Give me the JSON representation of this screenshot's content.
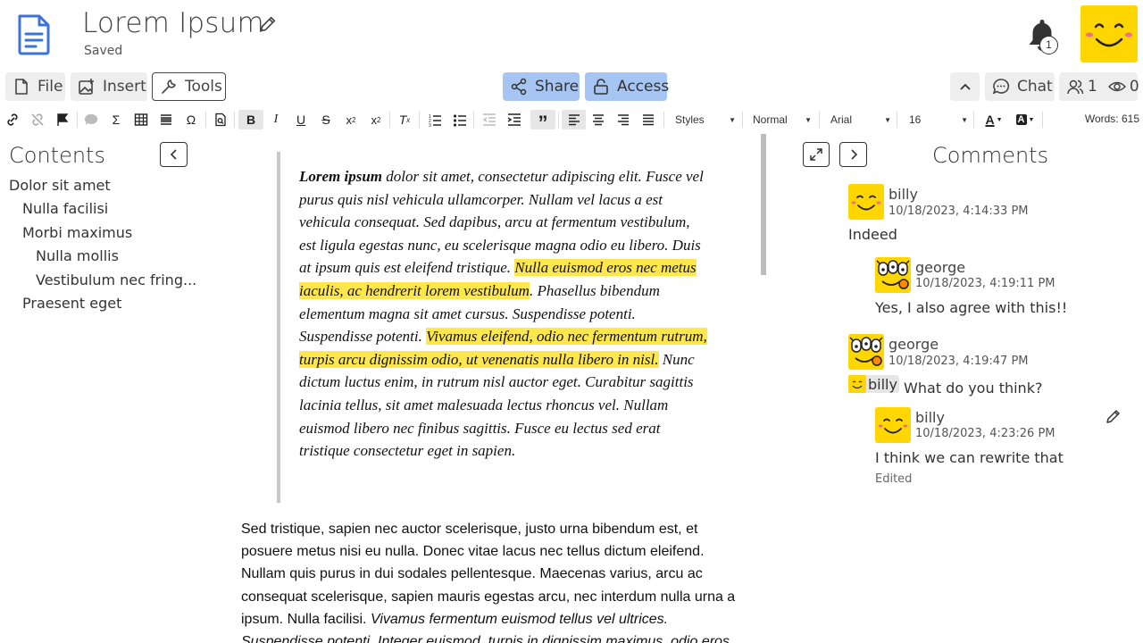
{
  "header": {
    "title": "Lorem Ipsum",
    "status": "Saved",
    "notification_count": "1"
  },
  "menu": {
    "file": "File",
    "insert": "Insert",
    "tools": "Tools",
    "share": "Share",
    "access": "Access",
    "chat": "Chat",
    "users_count": "1",
    "viewers_count": "0"
  },
  "toolbar": {
    "styles": "Styles",
    "paragraph": "Normal",
    "font": "Arial",
    "size": "16",
    "words": "Words: 615"
  },
  "contents": {
    "title": "Contents",
    "items": [
      {
        "label": "Dolor sit amet",
        "level": 0
      },
      {
        "label": "Nulla facilisi",
        "level": 1
      },
      {
        "label": "Morbi maximus",
        "level": 1
      },
      {
        "label": "Nulla mollis",
        "level": 2
      },
      {
        "label": "Vestibulum nec fring...",
        "level": 2
      },
      {
        "label": "Praesent eget",
        "level": 1
      }
    ]
  },
  "document": {
    "quote_bold": "Lorem ipsum",
    "quote_1": " dolor sit amet, consectetur adipiscing elit. Fusce vel purus quis nisl vehicula ullamcorper. Nullam vel lacus a est vehicula consequat. Sed dapibus, arcu at fermentum vestibulum, est ligula egestas nunc, eu scelerisque magna odio eu libero. Duis at ipsum quis est eleifend tristique. ",
    "quote_hl_1": "Nulla euismod eros nec metus iaculis, ac hendrerit lorem vestibulum",
    "quote_2": ". Phasellus bibendum elementum magna sit amet cursus. Suspendisse potenti. Suspendisse potenti. ",
    "quote_hl_2": "Vivamus eleifend, odio nec fermentum rutrum, turpis arcu dignissim odio, ut venenatis nulla libero in nisl.",
    "quote_3": " Nunc dictum luctus enim, in rutrum nisl auctor eget. Curabitur sagittis lacinia tellus, sit amet malesuada lectus rhoncus vel. Nullam euismod libero nec finibus sagittis. Fusce eu lectus sed erat tristique consectetur eget in sapien.",
    "para_1": "Sed tristique, sapien nec auctor scelerisque, justo urna bibendum est, et posuere metus nisi eu nulla. Donec vitae lacus nec tellus dictum eleifend. Nullam quis purus in dui sodales pellentesque. Maecenas varius, arcu ac consequat scelerisque, sapien mauris egestas arcu, nec interdum nulla urna a ipsum. Nulla facilisi. ",
    "para_italic": "Vivamus fermentum euismod tellus vel ultrices. Suspendisse potenti. Integer euismod, turpis in dignissim maximus, odio eros"
  },
  "comments": {
    "title": "Comments",
    "thread": [
      {
        "author": "billy",
        "time": "10/18/2023, 4:14:33 PM",
        "text": "Indeed"
      },
      {
        "author": "george",
        "time": "10/18/2023, 4:19:11 PM",
        "text": "Yes, I also agree with this!!"
      },
      {
        "author": "george",
        "time": "10/18/2023, 4:19:47 PM",
        "mention": "billy",
        "text": " What do you think?"
      },
      {
        "author": "billy",
        "time": "10/18/2023, 4:23:26 PM",
        "text": "I think we can rewrite that",
        "edited": "Edited"
      }
    ]
  }
}
